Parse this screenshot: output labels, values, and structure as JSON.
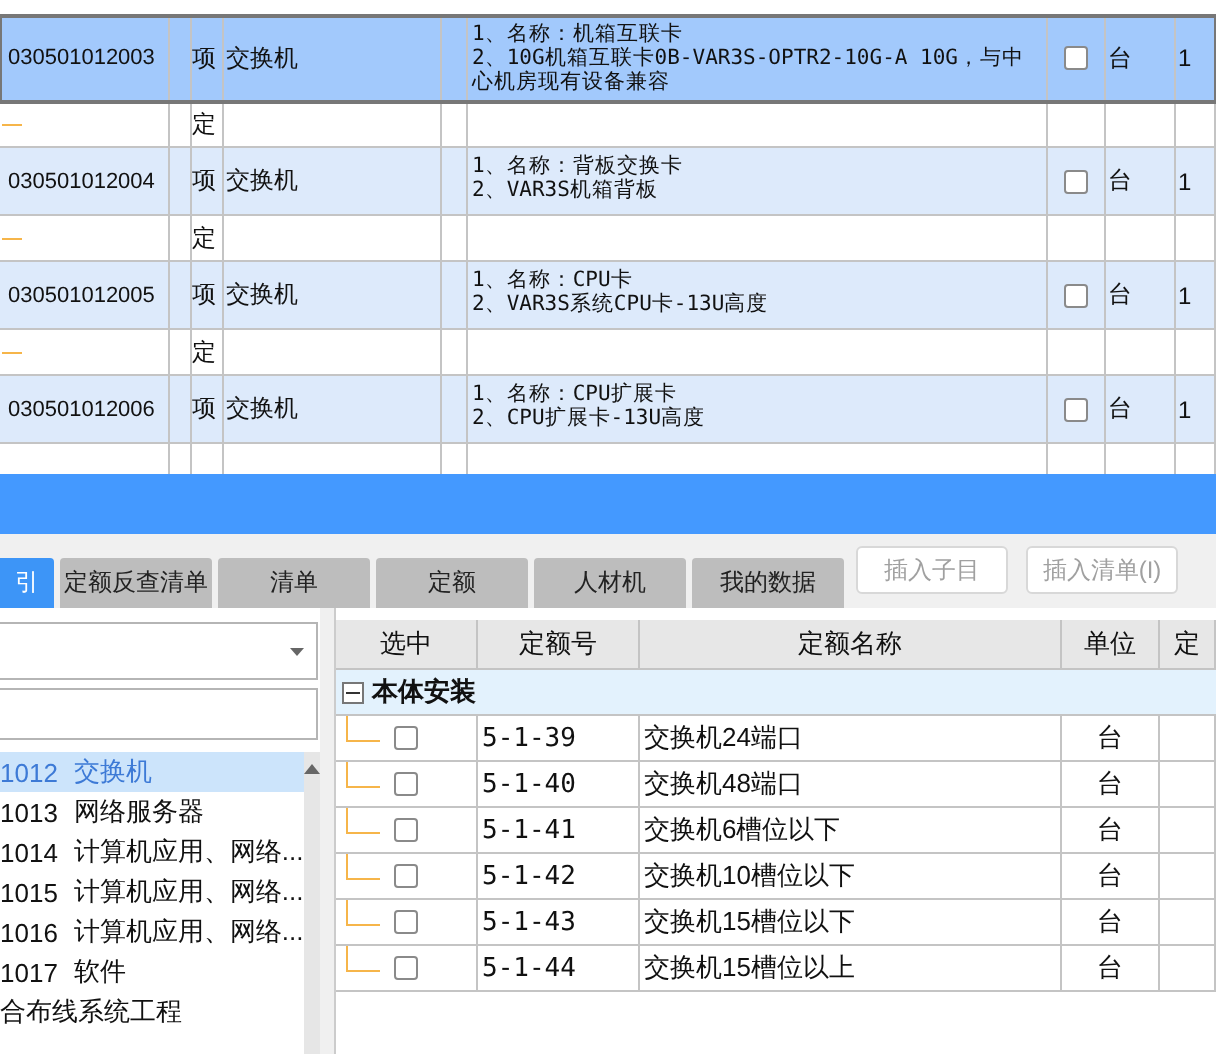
{
  "bill_table": {
    "rows": [
      {
        "kind": "item",
        "code": "030501012003",
        "type": "项",
        "name": "交换机",
        "description": [
          "1、名称：机箱互联卡",
          "2、10G机箱互联卡0B-VAR3S-OPTR2-10G-A 10G，与中心机房现有设备兼容"
        ],
        "checked": false,
        "unit": "台",
        "quantity": "1",
        "selected": true
      },
      {
        "kind": "sub",
        "type": "定"
      },
      {
        "kind": "item",
        "code": "030501012004",
        "type": "项",
        "name": "交换机",
        "description": [
          "1、名称：背板交换卡",
          "2、VAR3S机箱背板"
        ],
        "checked": false,
        "unit": "台",
        "quantity": "1",
        "selected": false
      },
      {
        "kind": "sub",
        "type": "定"
      },
      {
        "kind": "item",
        "code": "030501012005",
        "type": "项",
        "name": "交换机",
        "description": [
          "1、名称：CPU卡",
          "2、VAR3S系统CPU卡-13U高度"
        ],
        "checked": false,
        "unit": "台",
        "quantity": "1",
        "selected": false
      },
      {
        "kind": "sub",
        "type": "定"
      },
      {
        "kind": "item",
        "code": "030501012006",
        "type": "项",
        "name": "交换机",
        "description": [
          "1、名称：CPU扩展卡",
          "2、CPU扩展卡-13U高度"
        ],
        "checked": false,
        "unit": "台",
        "quantity": "1",
        "selected": false
      }
    ]
  },
  "tabs": [
    {
      "label": "引",
      "selected": true
    },
    {
      "label": "定额反查清单",
      "selected": false
    },
    {
      "label": "清单",
      "selected": false
    },
    {
      "label": "定额",
      "selected": false
    },
    {
      "label": "人材机",
      "selected": false
    },
    {
      "label": "我的数据",
      "selected": false
    }
  ],
  "actions": [
    {
      "label": "插入子目",
      "disabled": true
    },
    {
      "label": "插入清单(I)",
      "disabled": true
    }
  ],
  "chapter_list": {
    "items": [
      {
        "code": "1012",
        "name": "交换机",
        "selected": true
      },
      {
        "code": "1013",
        "name": "网络服务器",
        "selected": false
      },
      {
        "code": "1014",
        "name": "计算机应用、网络...",
        "selected": false
      },
      {
        "code": "1015",
        "name": "计算机应用、网络...",
        "selected": false
      },
      {
        "code": "1016",
        "name": "计算机应用、网络...",
        "selected": false
      },
      {
        "code": "1017",
        "name": "软件",
        "selected": false
      },
      {
        "name": "合布线系统工程",
        "selected": false
      }
    ]
  },
  "quota_table": {
    "columns": [
      "选中",
      "定额号",
      "定额名称",
      "单位",
      "定"
    ],
    "group": {
      "label": "本体安装",
      "expanded": true
    },
    "rows": [
      {
        "checked": false,
        "code": "5-1-39",
        "name": "交换机24端口",
        "unit": "台"
      },
      {
        "checked": false,
        "code": "5-1-40",
        "name": "交换机48端口",
        "unit": "台"
      },
      {
        "checked": false,
        "code": "5-1-41",
        "name": "交换机6槽位以下",
        "unit": "台"
      },
      {
        "checked": false,
        "code": "5-1-42",
        "name": "交换机10槽位以下",
        "unit": "台"
      },
      {
        "checked": false,
        "code": "5-1-43",
        "name": "交换机15槽位以下",
        "unit": "台"
      },
      {
        "checked": false,
        "code": "5-1-44",
        "name": "交换机15槽位以上",
        "unit": "台"
      }
    ]
  }
}
